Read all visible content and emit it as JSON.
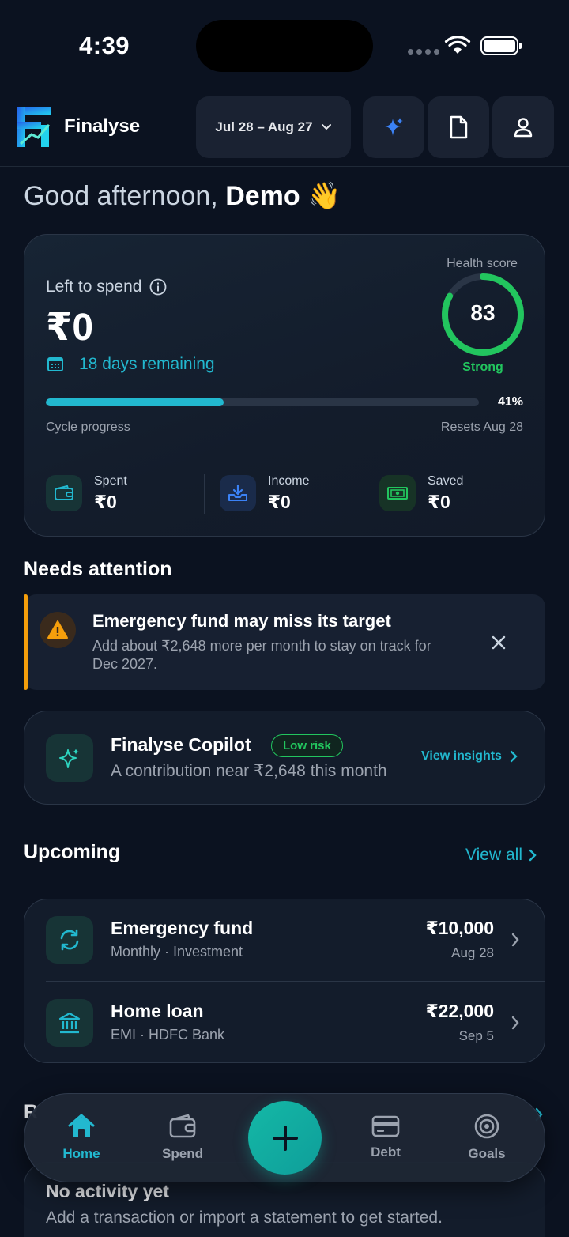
{
  "status_bar": {
    "time": "4:39"
  },
  "header": {
    "brand": "Finalyse",
    "date_range": "Jul 28 – Aug 27",
    "icons": [
      "sparkle-icon",
      "document-icon",
      "user-icon"
    ]
  },
  "greeting": {
    "prefix": "Good afternoon, ",
    "name": "Demo",
    "emoji": "👋"
  },
  "summary": {
    "left_to_spend_label": "Left to spend",
    "left_to_spend_value": "₹0",
    "days_remaining": "18 days remaining",
    "health_score_label": "Health score",
    "health_score_value": "83",
    "health_score_status": "Strong",
    "cycle_progress_pct": "41%",
    "cycle_progress_fraction": 0.41,
    "cycle_progress_label": "Cycle progress",
    "resets_label": "Resets Aug 28",
    "stats": [
      {
        "label": "Spent",
        "value": "₹0",
        "icon": "wallet-icon"
      },
      {
        "label": "Income",
        "value": "₹0",
        "icon": "inbox-download-icon"
      },
      {
        "label": "Saved",
        "value": "₹0",
        "icon": "cash-icon"
      }
    ]
  },
  "needs_attention": {
    "title": "Needs attention",
    "alert": {
      "title": "Emergency fund may miss its target",
      "text": "Add about ₹2,648 more per month to stay on track for Dec 2027."
    }
  },
  "copilot": {
    "title": "Finalyse Copilot",
    "badge": "Low risk",
    "text": "A contribution near ₹2,648 this month",
    "action": "View insights"
  },
  "upcoming": {
    "title": "Upcoming",
    "view_all": "View all",
    "items": [
      {
        "title": "Emergency fund",
        "subtitle": "Monthly · Investment",
        "amount": "₹10,000",
        "date": "Aug 28",
        "icon": "refresh-icon"
      },
      {
        "title": "Home loan",
        "subtitle": "EMI · HDFC Bank",
        "amount": "₹22,000",
        "date": "Sep 5",
        "icon": "bank-icon"
      }
    ]
  },
  "recent": {
    "title_fragment": "R",
    "empty_title": "No activity yet",
    "empty_text": "Add a transaction or import a statement to get started."
  },
  "nav": {
    "items": [
      {
        "label": "Home",
        "active": true
      },
      {
        "label": "Spend",
        "active": false
      },
      {
        "label": "Debt",
        "active": false
      },
      {
        "label": "Goals",
        "active": false
      }
    ]
  },
  "colors": {
    "background": "#0b1220",
    "accent": "#22b8cf",
    "success": "#22c55e",
    "warning": "#f59e0b"
  }
}
